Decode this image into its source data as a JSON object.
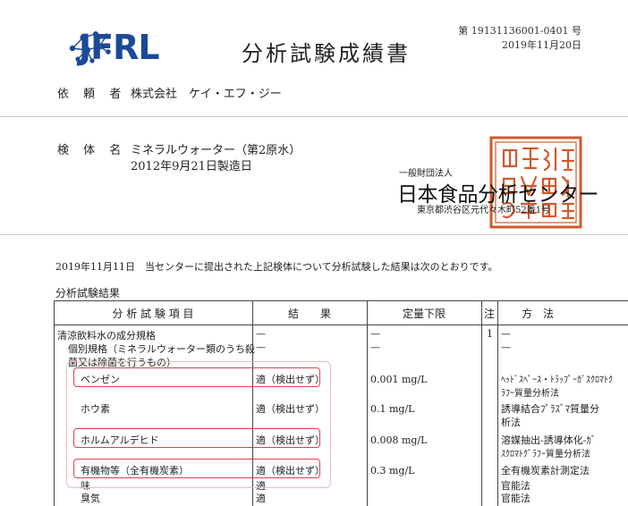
{
  "header": {
    "logo_text": "JFRL",
    "title": "分析試験成績書",
    "doc_number": "第 19131136001-0401 号",
    "issue_date": "2019年11月20日"
  },
  "client": {
    "label": "依 頼 者",
    "value": "株式会社　ケイ・エフ・ジー"
  },
  "sample": {
    "label": "検 体 名",
    "name": "ミネラルウォーター（第2原水）",
    "manufacture_date": "2012年9月21日製造日"
  },
  "issuer": {
    "corporate_type": "一般財団法人",
    "name": "日本食品分析センター",
    "address": "東京都渋谷区元代々木町52番1号"
  },
  "statement": "2019年11月11日　当センターに提出された上記検体について分析試験した結果は次のとおりです。",
  "section_title": "分析試験結果",
  "table": {
    "headers": [
      "分 析 試 験 項 目",
      "結　　果",
      "定量下限",
      "注",
      "方　法"
    ],
    "rows": [
      {
        "item": "清涼飲料水の成分規格",
        "result": "—",
        "limit": "—",
        "note": "1",
        "method": "—"
      },
      {
        "item": "個別規格（ミネラルウォーター類のうち殺",
        "result": "—",
        "limit": "—",
        "note": "",
        "method": "—"
      },
      {
        "item": "菌又は除菌を行うもの）",
        "result": "",
        "limit": "",
        "note": "",
        "method": ""
      },
      {
        "item": "ベンゼン",
        "result": "適（検出せず）",
        "limit": "0.001 mg/L",
        "note": "",
        "method": "ﾍｯﾄﾞｽﾍﾟｰｽ・ﾄﾗｯﾌﾟｰｶﾞｽｸﾛﾏﾄｸ",
        "method2": "ﾗﾌｰ質量分析法"
      },
      {
        "item": "ホウ素",
        "result": "適（検出せず）",
        "limit": "0.1 mg/L",
        "note": "",
        "method": "誘導結合ﾌﾟﾗｽﾞﾏ質量分",
        "method2": "析法"
      },
      {
        "item": "ホルムアルデヒド",
        "result": "適（検出せず）",
        "limit": "0.008 mg/L",
        "note": "",
        "method": "溶媒抽出-誘導体化-ｶﾞ",
        "method2": "ｽｸﾛﾏﾄｸﾞﾗﾌｰ質量分析法"
      },
      {
        "item": "有機物等（全有機炭素）",
        "result": "適（検出せず）",
        "limit": "0.3 mg/L",
        "note": "",
        "method": "全有機炭素計測定法"
      },
      {
        "item": "味",
        "result": "適",
        "limit": "",
        "note": "",
        "method": "官能法"
      },
      {
        "item": "臭気",
        "result": "適",
        "limit": "",
        "note": "",
        "method": "官能法"
      }
    ]
  },
  "colors": {
    "logo_blue": "#1b4a97",
    "seal_red": "#d2592c",
    "highlight": "#d9434e"
  },
  "icons": {
    "logo": "molecule-network-icon",
    "seal": "official-seal"
  }
}
